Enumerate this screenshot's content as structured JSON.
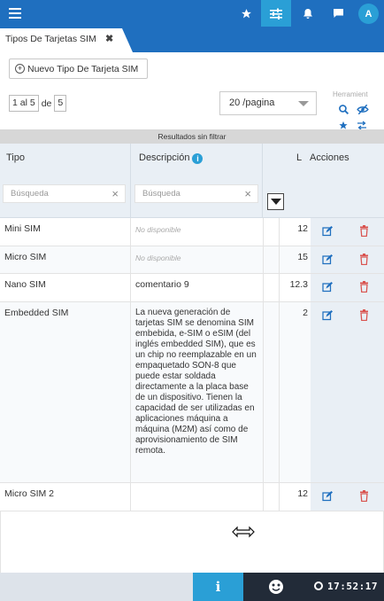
{
  "topbar": {
    "avatar_initial": "A",
    "icons": [
      "menu-icon",
      "star-icon",
      "sliders-icon",
      "bell-icon",
      "chat-icon"
    ]
  },
  "tab": {
    "label": "Tipos De Tarjetas SIM",
    "close": "✖"
  },
  "toolbar": {
    "new_button_label": "Nuevo Tipo De Tarjeta SIM",
    "pager": {
      "range": "1 al 5",
      "of_label": "de",
      "total": "5"
    },
    "per_page": "20 /pagina",
    "tools_label": "Herramient"
  },
  "results_label": "Resultados sin filtrar",
  "table": {
    "headers": {
      "tipo": "Tipo",
      "descripcion": "Descripción",
      "l": "L",
      "acciones": "Acciones"
    },
    "search_placeholder_tipo": "Búsqueda",
    "search_placeholder_desc": "Búsqueda",
    "rows": [
      {
        "tipo": "Mini SIM",
        "descripcion": "No disponible",
        "l": "12"
      },
      {
        "tipo": "Micro SIM",
        "descripcion": "No disponible",
        "l": "15"
      },
      {
        "tipo": "Nano SIM",
        "descripcion": "comentario 9",
        "l": "12.3"
      },
      {
        "tipo": "Embedded SIM",
        "descripcion": "La nueva generación de tarjetas SIM se denomina SIM embebida, e-SIM o eSIM (del inglés embedded SIM), que es un chip no reemplazable en un empaquetado SON-8 que puede estar soldada directamente a la placa base de un dispositivo. Tienen la capacidad de ser utilizadas en aplicaciones máquina a máquina (M2M) así como de aprovisionamiento de SIM remota.",
        "l": "2"
      },
      {
        "tipo": "Micro SIM 2",
        "descripcion": "",
        "l": "12"
      }
    ]
  },
  "footer": {
    "info_glyph": "i",
    "time": "17:52:17"
  },
  "colors": {
    "primary": "#1f6fbf",
    "accent": "#2a9fd6",
    "delete": "#d9534f",
    "footer_dark": "#222b38"
  }
}
